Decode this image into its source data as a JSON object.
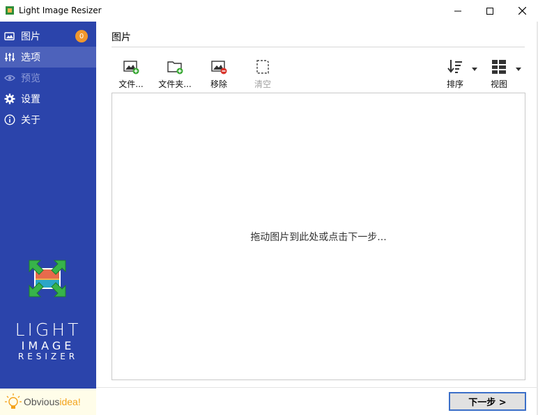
{
  "window": {
    "title": "Light Image Resizer"
  },
  "sidebar": {
    "items": [
      {
        "label": "图片",
        "icon": "images-icon",
        "badge": "0",
        "state": "normal"
      },
      {
        "label": "选项",
        "icon": "sliders-icon",
        "state": "active"
      },
      {
        "label": "预览",
        "icon": "eye-icon",
        "state": "disabled"
      },
      {
        "label": "设置",
        "icon": "gear-icon",
        "state": "normal"
      },
      {
        "label": "关于",
        "icon": "info-icon",
        "state": "normal"
      }
    ],
    "brand": {
      "line1": "LIGHT",
      "line2": "IMAGE",
      "line3": "RESIZER"
    },
    "company": {
      "prefix": "Obvious",
      "suffix": "idea!"
    }
  },
  "main": {
    "section_title": "图片",
    "toolbar": {
      "add_file": "文件...",
      "add_folder": "文件夹...",
      "remove": "移除",
      "clear": "清空",
      "sort": "排序",
      "view": "视图"
    },
    "drop_hint": "拖动图片到此处或点击下一步...",
    "next_button": "下一步 >"
  },
  "colors": {
    "sidebar_bg": "#2b44ab",
    "sidebar_active": "#4d62bb",
    "badge": "#f0972d",
    "accent_border": "#3b6fc8"
  }
}
